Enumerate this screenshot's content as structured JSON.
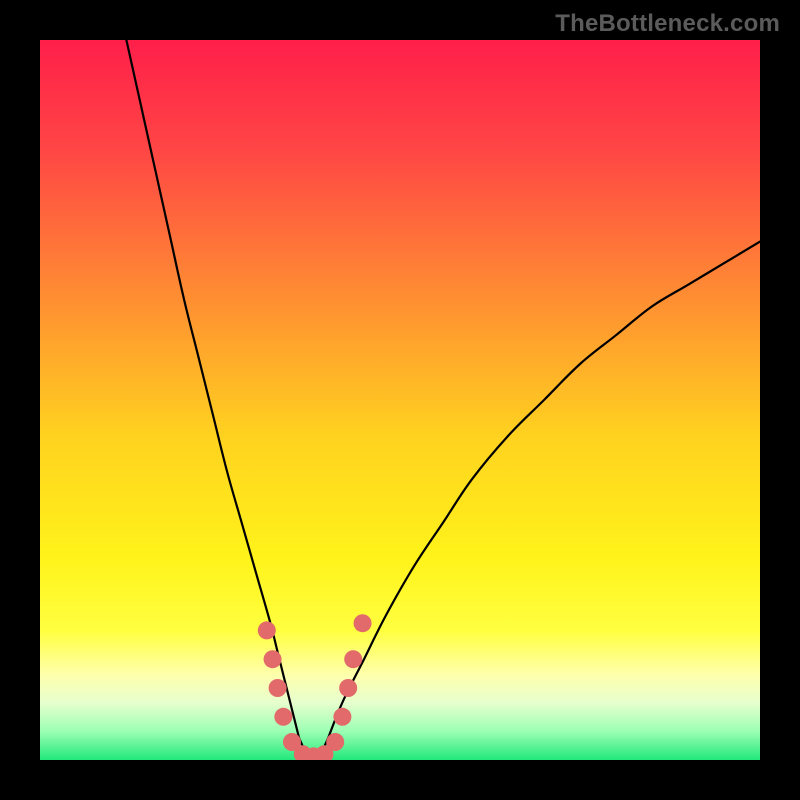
{
  "watermark": "TheBottleneck.com",
  "chart_data": {
    "type": "line",
    "title": "",
    "xlabel": "",
    "ylabel": "",
    "xlim": [
      0,
      100
    ],
    "ylim": [
      0,
      100
    ],
    "grid": false,
    "legend": false,
    "gradient_stops": [
      {
        "offset": 0.0,
        "color": "#ff1f4a"
      },
      {
        "offset": 0.15,
        "color": "#ff4545"
      },
      {
        "offset": 0.35,
        "color": "#ff8b33"
      },
      {
        "offset": 0.55,
        "color": "#ffd21f"
      },
      {
        "offset": 0.72,
        "color": "#fff31a"
      },
      {
        "offset": 0.82,
        "color": "#ffff40"
      },
      {
        "offset": 0.88,
        "color": "#ffffaa"
      },
      {
        "offset": 0.92,
        "color": "#e7ffce"
      },
      {
        "offset": 0.96,
        "color": "#9cffb4"
      },
      {
        "offset": 1.0,
        "color": "#22e87a"
      }
    ],
    "series": [
      {
        "name": "left-branch",
        "x": [
          12,
          14,
          16,
          18,
          20,
          22,
          24,
          26,
          28,
          30,
          32,
          33,
          34,
          35,
          36
        ],
        "y": [
          100,
          91,
          82,
          73,
          64,
          56,
          48,
          40,
          33,
          26,
          19,
          15,
          11,
          7,
          3
        ]
      },
      {
        "name": "right-branch",
        "x": [
          40,
          42,
          45,
          48,
          52,
          56,
          60,
          65,
          70,
          75,
          80,
          85,
          90,
          95,
          100
        ],
        "y": [
          3,
          8,
          14,
          20,
          27,
          33,
          39,
          45,
          50,
          55,
          59,
          63,
          66,
          69,
          72
        ]
      },
      {
        "name": "valley-floor",
        "x": [
          36,
          37,
          38,
          39,
          40
        ],
        "y": [
          3,
          1,
          0.5,
          1,
          3
        ]
      }
    ],
    "markers": {
      "name": "highlight-dots",
      "color": "#e26a6a",
      "radius": 9,
      "points": [
        {
          "x": 31.5,
          "y": 18
        },
        {
          "x": 32.3,
          "y": 14
        },
        {
          "x": 33.0,
          "y": 10
        },
        {
          "x": 33.8,
          "y": 6
        },
        {
          "x": 35.0,
          "y": 2.5
        },
        {
          "x": 36.5,
          "y": 0.8
        },
        {
          "x": 38.0,
          "y": 0.5
        },
        {
          "x": 39.5,
          "y": 0.8
        },
        {
          "x": 41.0,
          "y": 2.5
        },
        {
          "x": 42.0,
          "y": 6
        },
        {
          "x": 42.8,
          "y": 10
        },
        {
          "x": 43.5,
          "y": 14
        },
        {
          "x": 44.8,
          "y": 19
        }
      ]
    }
  }
}
